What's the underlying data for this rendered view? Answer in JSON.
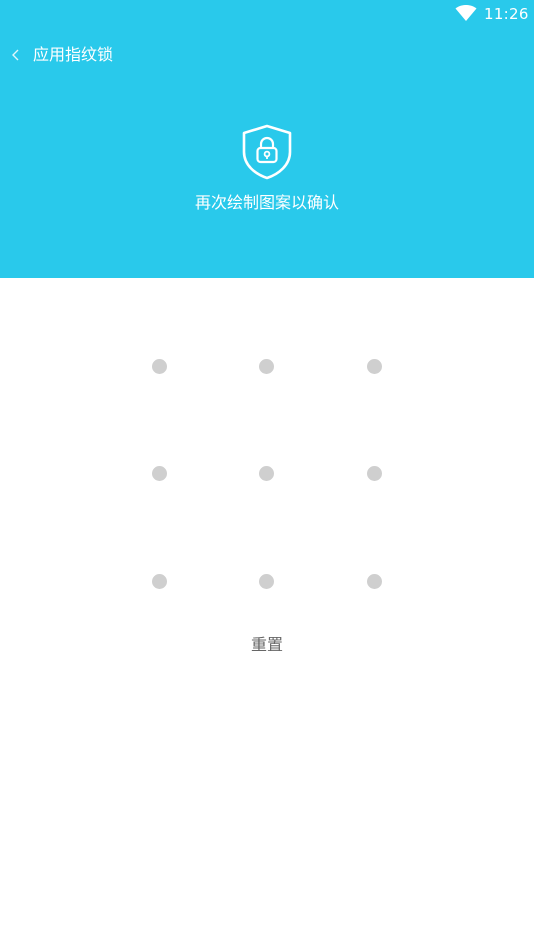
{
  "status_bar": {
    "time": "11:26",
    "wifi_icon": "wifi-icon"
  },
  "toolbar": {
    "back_icon": "chevron-left-icon",
    "title": "应用指纹锁"
  },
  "header": {
    "icon": "shield-lock-icon",
    "prompt": "再次绘制图案以确认"
  },
  "pattern": {
    "rows": 3,
    "columns": 3
  },
  "actions": {
    "reset_label": "重置"
  },
  "colors": {
    "header_background": "#29c9eb",
    "dot": "#cfcfcf",
    "reset_text": "#666666"
  }
}
